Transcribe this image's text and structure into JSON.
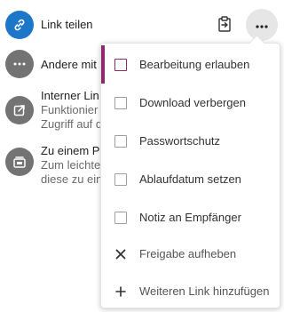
{
  "share_list": {
    "link": {
      "title": "Link teilen",
      "icon": "link-icon"
    },
    "other": {
      "title": "Andere mit"
    },
    "internal": {
      "title": "Interner Lin",
      "sub1": "Funktionier",
      "sub2": "Zugriff auf d",
      "icon": "external-link-icon"
    },
    "project": {
      "title": "Zu einem Pr",
      "sub1": "Zum leichte",
      "sub2": "diese zu ein",
      "icon": "project-icon"
    }
  },
  "actions": {
    "clipboard_icon": "clipboard-icon",
    "more_icon": "more-horizontal-icon"
  },
  "menu": {
    "items": [
      {
        "label": "Bearbeitung erlauben",
        "type": "checkbox",
        "checked": false,
        "active": true
      },
      {
        "label": "Download verbergen",
        "type": "checkbox",
        "checked": false
      },
      {
        "label": "Passwortschutz",
        "type": "checkbox",
        "checked": false
      },
      {
        "label": "Ablaufdatum setzen",
        "type": "checkbox",
        "checked": false
      },
      {
        "label": "Notiz an Empfänger",
        "type": "checkbox",
        "checked": false
      },
      {
        "label": "Freigabe aufheben",
        "type": "action",
        "icon": "close-icon"
      },
      {
        "label": "Weiteren Link hinzufügen",
        "type": "action",
        "icon": "plus-icon"
      }
    ]
  },
  "colors": {
    "link_avatar": "#1d77c9",
    "grey_avatar": "#737373",
    "active_accent": "#8e2a6b"
  }
}
